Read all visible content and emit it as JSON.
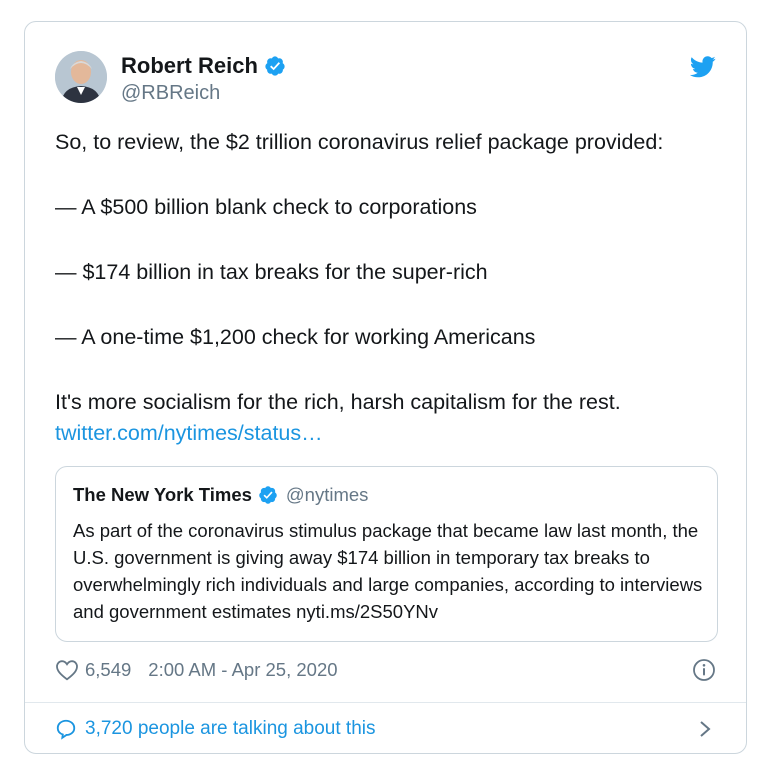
{
  "tweet": {
    "author_name": "Robert Reich",
    "author_handle": "@RBReich",
    "lines": [
      "So, to review, the $2 trillion coronavirus relief package provided:",
      "— A $500 billion blank check to corporations",
      "— $174 billion in tax breaks for the super-rich",
      "— A one-time $1,200 check for working Americans",
      "It's more socialism for the rich, harsh capitalism for the rest."
    ],
    "link_text": "twitter.com/nytimes/status…",
    "likes": "6,549",
    "timestamp": "2:00 AM - Apr 25, 2020",
    "talking": "3,720 people are talking about this"
  },
  "quote": {
    "name": "The New York Times",
    "handle": "@nytimes",
    "text": "As part of the coronavirus stimulus package that became law last month, the U.S. government is giving away $174 billion in temporary tax breaks to overwhelmingly rich individuals and large companies, according to interviews and government estimates nyti.ms/2S50YNv"
  },
  "colors": {
    "link": "#1b95e0",
    "muted": "#657786",
    "text": "#14171a",
    "verified": "#1da1f2"
  },
  "icons": [
    "twitter-bird-icon",
    "verified-badge-icon",
    "heart-icon",
    "info-icon",
    "comment-icon",
    "chevron-right-icon"
  ]
}
